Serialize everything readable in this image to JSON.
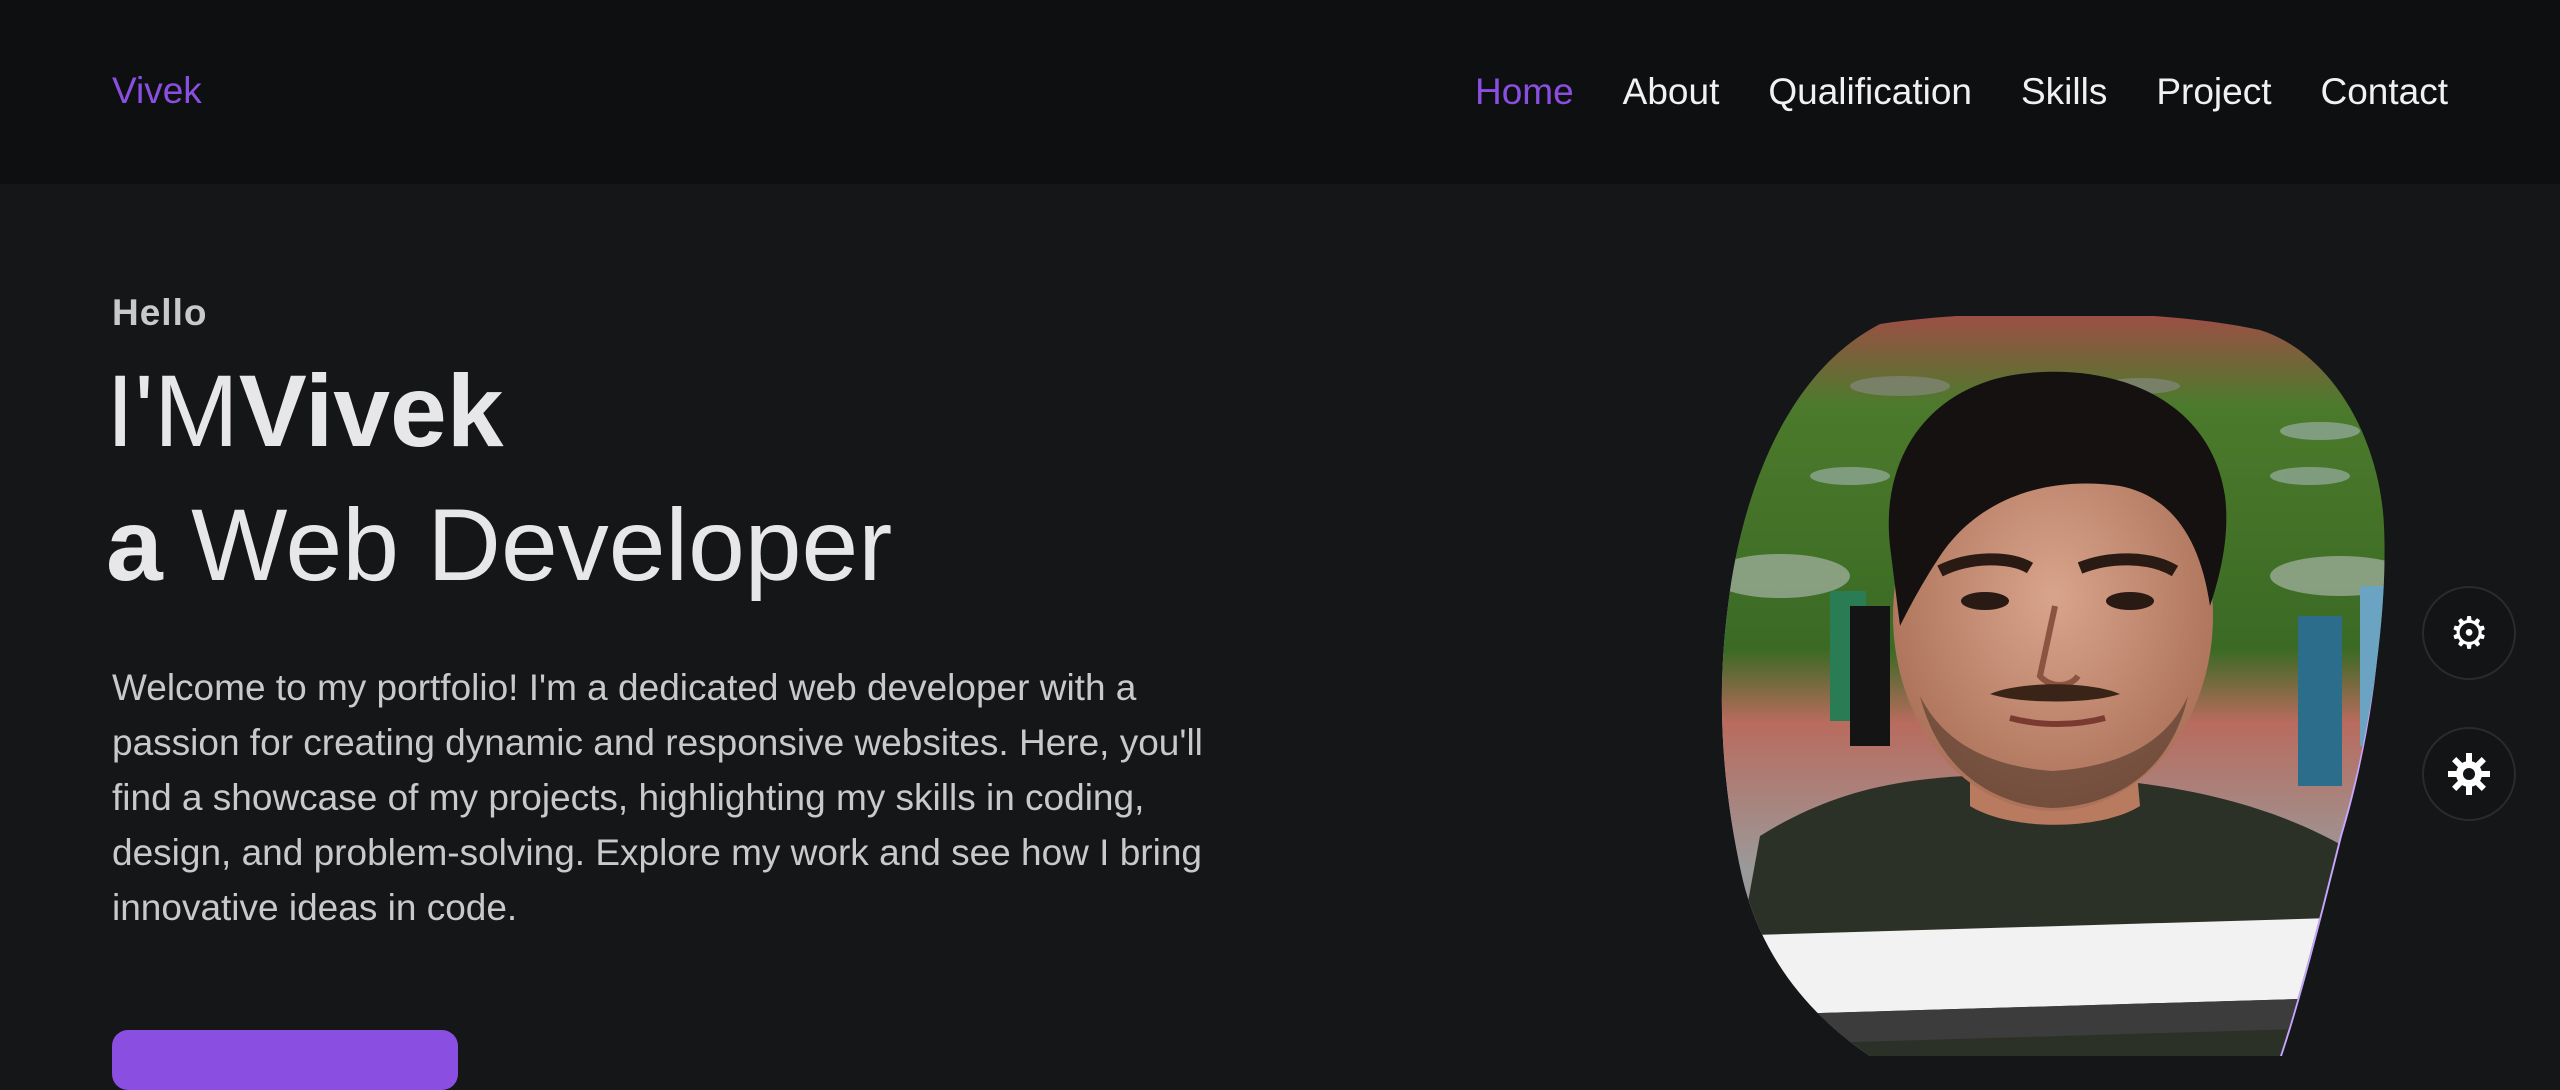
{
  "header": {
    "logo": "Vivek",
    "nav": [
      "Home",
      "About",
      "Qualification",
      "Skills",
      "Project",
      "Contact"
    ],
    "active": "Home"
  },
  "hero": {
    "greeting": "Hello",
    "line1_light": "I'M",
    "line1_bold": "Vivek",
    "line2_bold": "a",
    "line2_light": "Web Developer",
    "description": "Welcome to my portfolio! I'm a dedicated web developer with a passion for creating dynamic and responsive websites. Here, you'll find a showcase of my projects, highlighting my skills in coding, design, and problem-solving. Explore my work and see how I bring innovative ideas in code.",
    "cta_label": ""
  },
  "side_buttons": [
    {
      "icon": "gear-icon"
    },
    {
      "icon": "settings-cog-icon"
    }
  ],
  "colors": {
    "accent": "#8a4fe0",
    "blob": "#c6a6ff",
    "bg": "#151618",
    "header_bg": "#0e0f10"
  }
}
